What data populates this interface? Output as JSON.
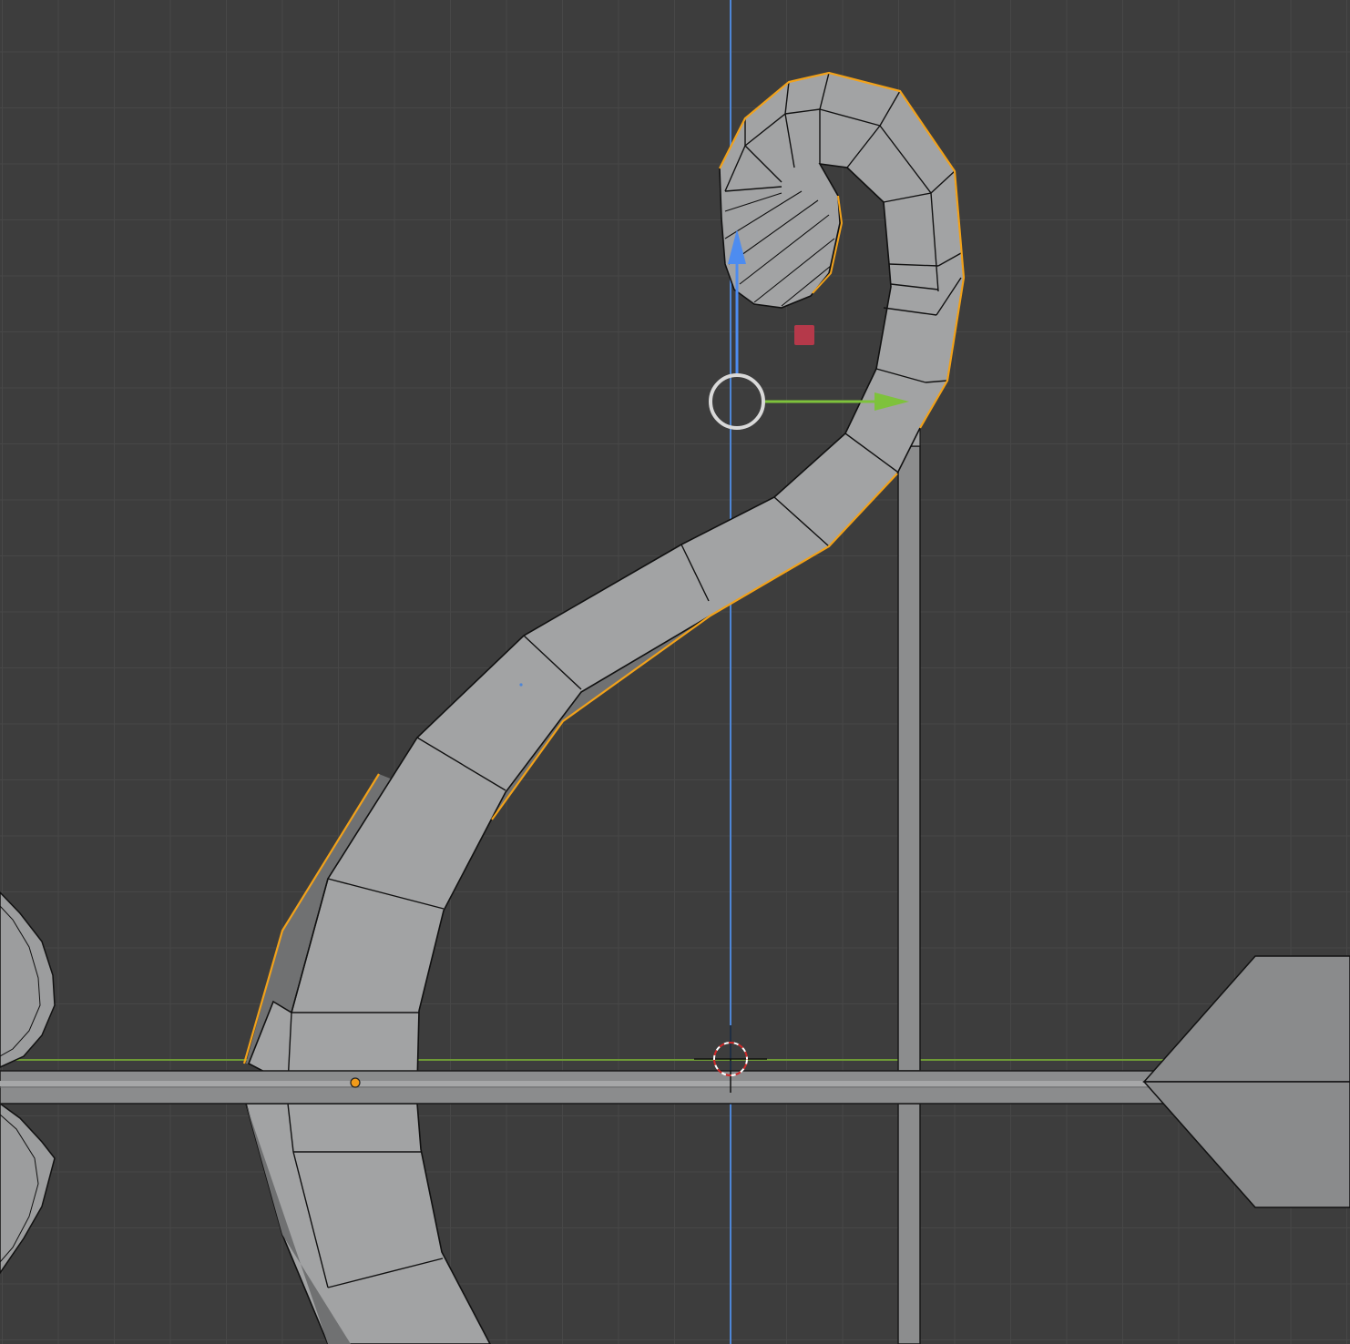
{
  "viewport": {
    "view_type": "3d-viewport-orthographic-side",
    "background_color": "#3d3d3d",
    "grid_color": "#474747",
    "axis_colors": {
      "z_axis": "#4e86d6",
      "y_axis": "#7bb33a"
    },
    "selection_outline_color": "#f2a21a",
    "mesh_face_color": "#a2a3a4",
    "mesh_shadow_color": "#6f7071",
    "wire_color": "#111111"
  },
  "scene": {
    "objects": [
      {
        "name": "bow-limb",
        "selected": true
      },
      {
        "name": "bow-string",
        "selected": false
      },
      {
        "name": "arrow-shaft",
        "selected": false
      },
      {
        "name": "arrow-fletching",
        "selected": false
      },
      {
        "name": "side-sphere",
        "selected": false
      }
    ]
  },
  "gizmos": {
    "transform": {
      "mode": "move",
      "z_arrow_color": "#4d8cf0",
      "y_arrow_color": "#7ec23c",
      "plane_handle_color": "#b5394a",
      "center_ring_color": "#d9d9d9"
    },
    "cursor_3d": {
      "name": "3d-cursor"
    },
    "origin_point": {
      "name": "object-origin",
      "color": "#f29b1a"
    }
  }
}
